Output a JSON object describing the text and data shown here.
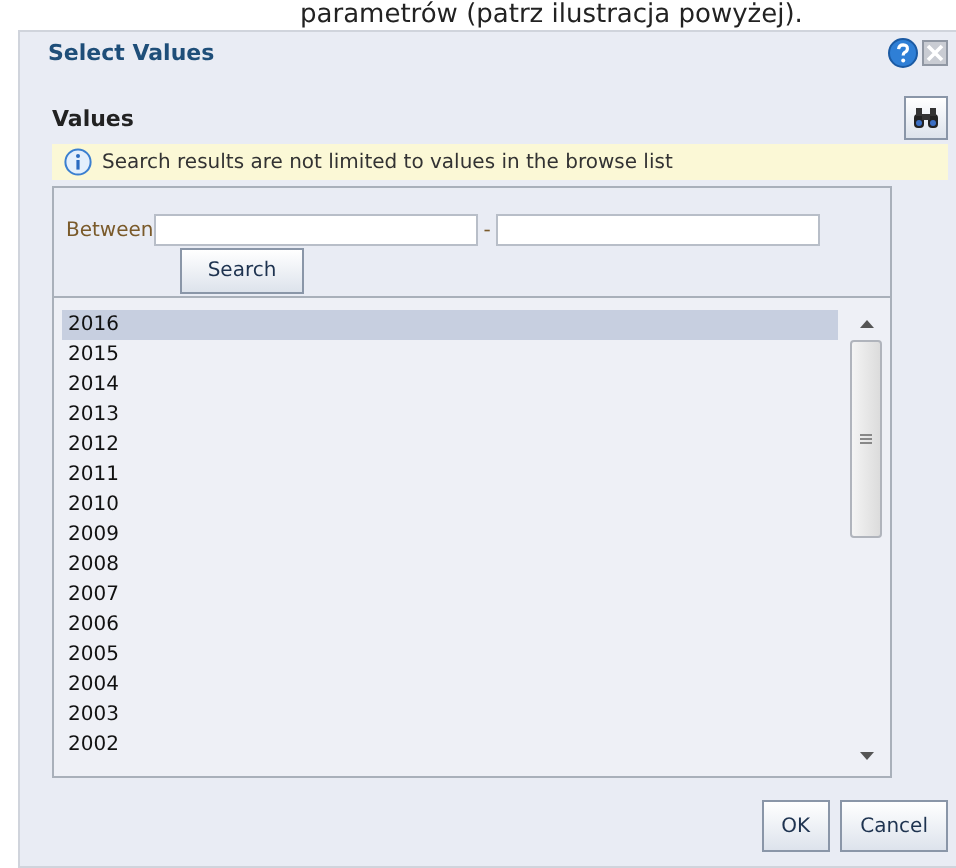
{
  "document_text": "parametrów (patrz ilustracja powyżej).",
  "dialog": {
    "title": "Select Values",
    "heading": "Values",
    "info": "Search results are not limited to values in the browse list",
    "filter": {
      "label": "Between",
      "separator": "-",
      "search_button": "Search"
    },
    "values": [
      {
        "label": "2016",
        "selected": true
      },
      {
        "label": "2015",
        "selected": false
      },
      {
        "label": "2014",
        "selected": false
      },
      {
        "label": "2013",
        "selected": false
      },
      {
        "label": "2012",
        "selected": false
      },
      {
        "label": "2011",
        "selected": false
      },
      {
        "label": "2010",
        "selected": false
      },
      {
        "label": "2009",
        "selected": false
      },
      {
        "label": "2008",
        "selected": false
      },
      {
        "label": "2007",
        "selected": false
      },
      {
        "label": "2006",
        "selected": false
      },
      {
        "label": "2005",
        "selected": false
      },
      {
        "label": "2004",
        "selected": false
      },
      {
        "label": "2003",
        "selected": false
      },
      {
        "label": "2002",
        "selected": false
      }
    ],
    "buttons": [
      "OK",
      "Cancel"
    ]
  }
}
